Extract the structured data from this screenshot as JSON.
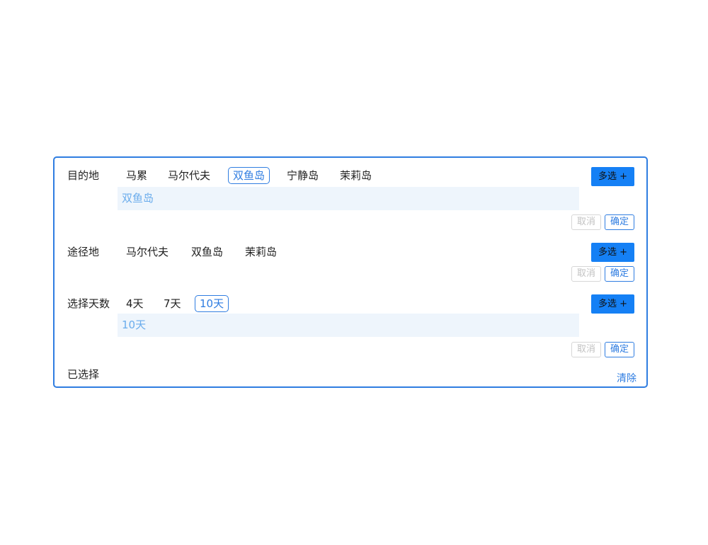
{
  "destination": {
    "label": "目的地",
    "options": [
      "马累",
      "马尔代夫",
      "双鱼岛",
      "宁静岛",
      "茉莉岛"
    ],
    "selected_value": "双鱼岛",
    "multi_label": "多选 +",
    "cancel_label": "取消",
    "confirm_label": "确定"
  },
  "route": {
    "label": "途径地",
    "options": [
      "马尔代夫",
      "双鱼岛",
      "茉莉岛"
    ],
    "multi_label": "多选 +",
    "cancel_label": "取消",
    "confirm_label": "确定"
  },
  "days": {
    "label": "选择天数",
    "options": [
      "4天",
      "7天",
      "10天"
    ],
    "selected_value": "10天",
    "multi_label": "多选 +",
    "cancel_label": "取消",
    "confirm_label": "确定"
  },
  "selected": {
    "label": "已选择",
    "clear_label": "清除"
  },
  "colors": {
    "accent": "#2f7de1",
    "multi_button_bg": "#1580f5",
    "selected_bar_bg": "#eef5fc"
  }
}
